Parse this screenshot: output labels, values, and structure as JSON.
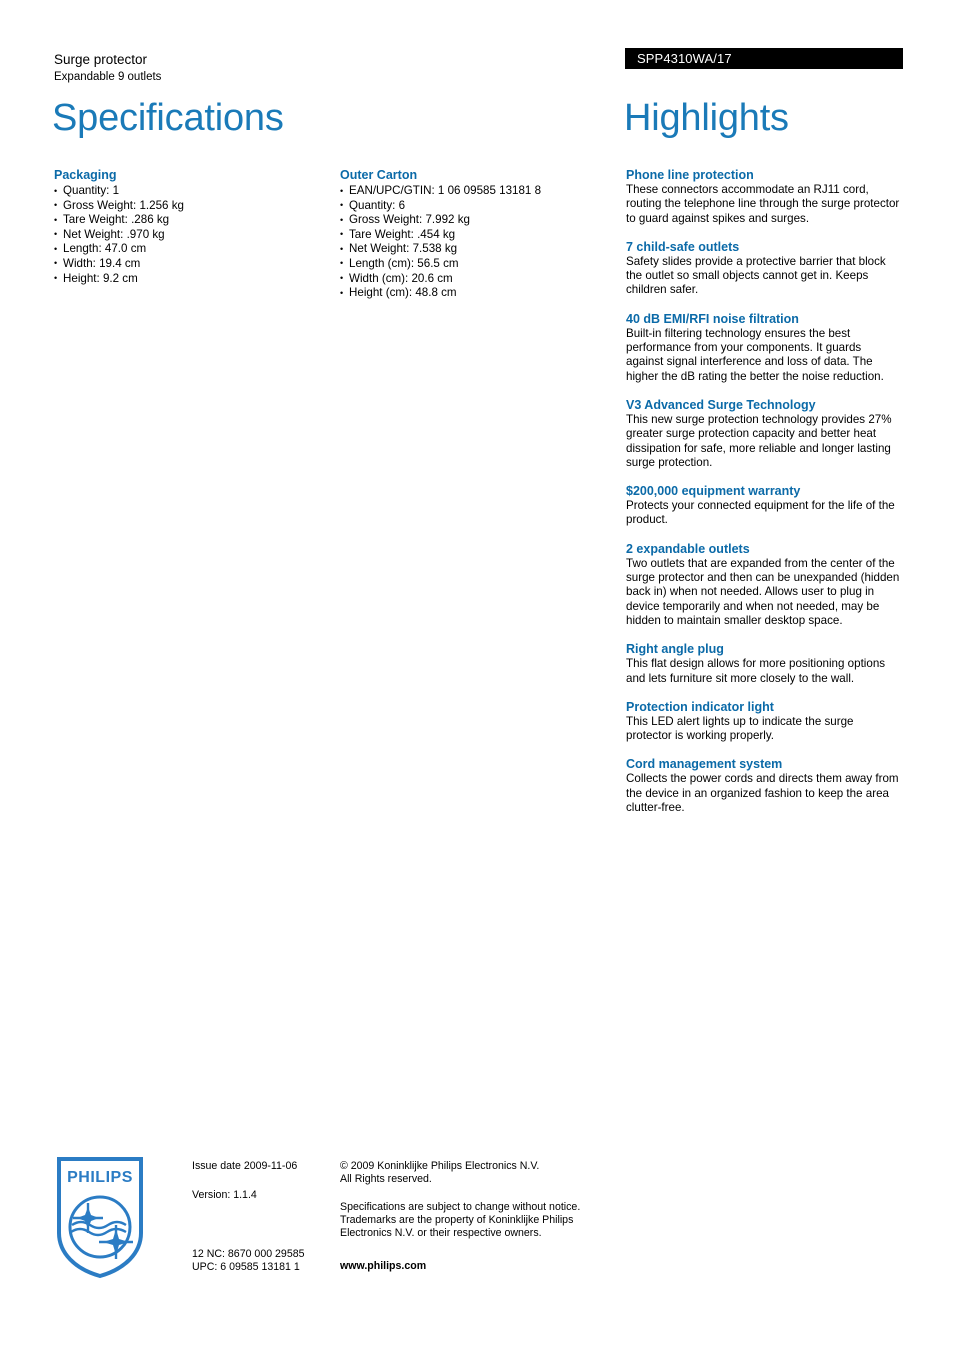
{
  "header": {
    "product_category": "Surge protector",
    "product_subtitle": "Expandable 9 outlets",
    "product_code": "SPP4310WA/17"
  },
  "titles": {
    "specifications": "Specifications",
    "highlights": "Highlights"
  },
  "specifications": {
    "packaging": {
      "heading": "Packaging",
      "items": [
        "Quantity: 1",
        "Gross Weight: 1.256 kg",
        "Tare Weight: .286 kg",
        "Net Weight: .970 kg",
        "Length: 47.0 cm",
        "Width: 19.4 cm",
        "Height: 9.2 cm"
      ]
    },
    "outer_carton": {
      "heading": "Outer Carton",
      "items": [
        "EAN/UPC/GTIN: 1 06 09585 13181 8",
        "Quantity: 6",
        "Gross Weight: 7.992 kg",
        "Tare Weight: .454 kg",
        "Net Weight: 7.538 kg",
        "Length (cm): 56.5 cm",
        "Width (cm): 20.6 cm",
        "Height (cm): 48.8 cm"
      ]
    }
  },
  "highlights": [
    {
      "heading": "Phone line protection",
      "body": "These connectors accommodate an RJ11 cord, routing the telephone line through the surge protector to guard against spikes and surges."
    },
    {
      "heading": "7 child-safe outlets",
      "body": "Safety slides provide a protective barrier that block the outlet so small objects cannot get in. Keeps children safer."
    },
    {
      "heading": "40 dB EMI/RFI noise filtration",
      "body": "Built-in filtering technology ensures the best performance from your components. It guards against signal interference and loss of data. The higher the dB rating the better the noise reduction."
    },
    {
      "heading": "V3 Advanced Surge Technology",
      "body": "This new surge protection technology provides 27% greater surge protection capacity and better heat dissipation for safe, more reliable and longer lasting surge protection."
    },
    {
      "heading": "$200,000 equipment warranty",
      "body": "Protects your connected equipment for the life of the product."
    },
    {
      "heading": "2 expandable outlets",
      "body": "Two outlets that are expanded from the center of the surge protector and then can be unexpanded (hidden back in) when not needed. Allows user to plug in device temporarily and when not needed, may be hidden to maintain smaller desktop space."
    },
    {
      "heading": "Right angle plug",
      "body": "This flat design allows for more positioning options and lets furniture sit more closely to the wall."
    },
    {
      "heading": "Protection indicator light",
      "body": "This LED alert lights up to indicate the surge protector is working properly."
    },
    {
      "heading": "Cord management system",
      "body": "Collects the power cords and directs them away from the device in an organized fashion to keep the area clutter-free."
    }
  ],
  "footer": {
    "logo_wordmark": "PHILIPS",
    "issue_date": "Issue date 2009-11-06",
    "version": "Version: 1.1.4",
    "twelve_nc": "12 NC: 8670 000 29585",
    "upc": "UPC: 6 09585 13181 1",
    "copyright_line1": "© 2009 Koninklijke Philips Electronics N.V.",
    "copyright_line2": "All Rights reserved.",
    "disclaimer_line1": "Specifications are subject to change without notice.",
    "disclaimer_line2": "Trademarks are the property of Koninklijke Philips",
    "disclaimer_line3": "Electronics N.V. or their respective owners.",
    "website": "www.philips.com"
  },
  "colors": {
    "title_blue": "#1a7ab8",
    "heading_blue": "#0b6aa8",
    "banner_bg": "#000000",
    "banner_text": "#ffffff"
  }
}
